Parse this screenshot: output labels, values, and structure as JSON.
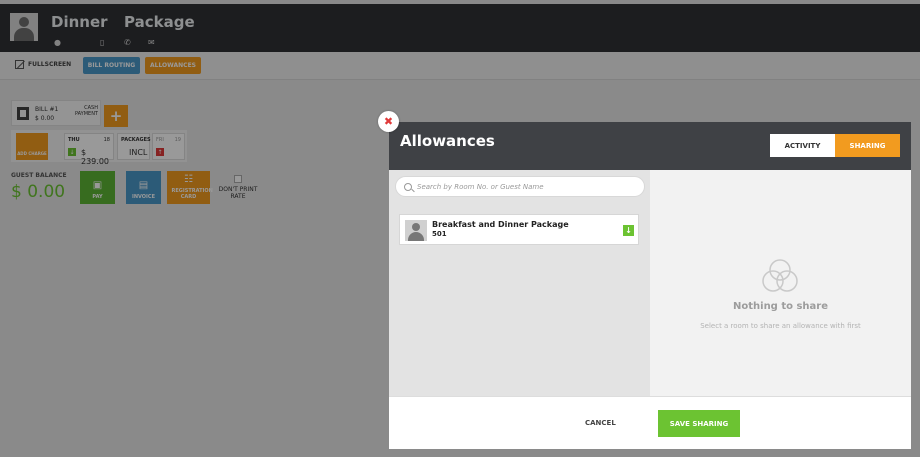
{
  "header": {
    "first_name": "Dinner",
    "last_name": "Package",
    "icons": [
      "location-icon",
      "mobile-icon",
      "phone-icon",
      "email-icon"
    ]
  },
  "toolbar": {
    "fullscreen": "FULLSCREEN",
    "bill_routing": "BILL ROUTING",
    "allowances": "ALLOWANCES",
    "colors": {
      "bill_routing": "#4a98c9",
      "allowances": "#f29b1f"
    }
  },
  "bill": {
    "label": "BILL #1",
    "amount": "$ 0.00",
    "payment_type": "CASH PAYMENT",
    "add_charge": "ADD CHARGE"
  },
  "stay_days": [
    {
      "day": "THU",
      "date": "18",
      "amount": "$ 239.00"
    },
    {
      "day": "PACKAGES",
      "date": "",
      "amount": "INCL"
    },
    {
      "day": "FRI",
      "date": "19",
      "amount": ""
    }
  ],
  "balance": {
    "label": "GUEST BALANCE",
    "value": "$ 0.00"
  },
  "actions": {
    "pay": "PAY",
    "invoice": "INVOICE",
    "registration_card": "REGISTRATION CARD",
    "dont_print_rate": "DON'T PRINT RATE"
  },
  "modal": {
    "title": "Allowances",
    "tab_activity": "ACTIVITY",
    "tab_sharing": "SHARING",
    "search_placeholder": "Search by Room No. or Guest Name",
    "room": {
      "name": "Breakfast and Dinner Package",
      "number": "501"
    },
    "empty_title": "Nothing to share",
    "empty_subtitle": "Select a room to share an allowance with first",
    "cancel": "CANCEL",
    "save": "SAVE SHARING",
    "accent_color": "#f29b1f",
    "save_color": "#6cc332"
  }
}
